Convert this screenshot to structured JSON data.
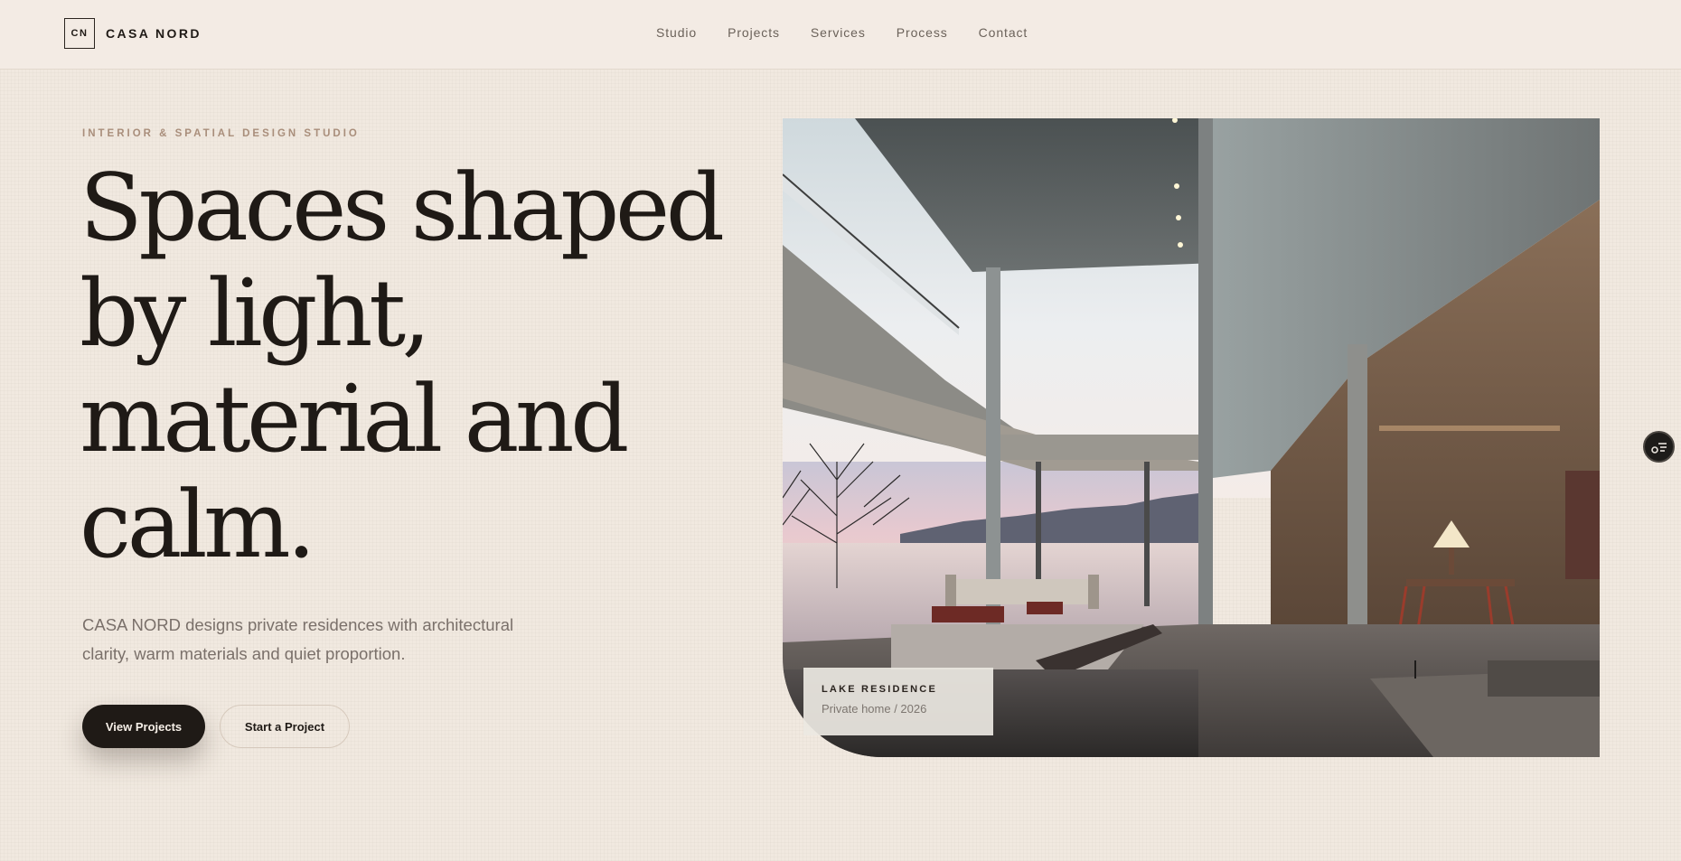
{
  "brand": {
    "mark": "CN",
    "name": "CASA NORD"
  },
  "nav": {
    "items": [
      "Studio",
      "Projects",
      "Services",
      "Process",
      "Contact"
    ]
  },
  "hero": {
    "eyebrow": "INTERIOR & SPATIAL DESIGN STUDIO",
    "headline": [
      "Spaces shaped",
      "by light,",
      "material and",
      "calm."
    ],
    "lead": "CASA NORD designs private residences with architectural clarity, warm materials and quiet proportion.",
    "primary_cta": "View Projects",
    "secondary_cta": "Start a Project"
  },
  "feature": {
    "caption_title": "LAKE RESIDENCE",
    "caption_sub": "Private home / 2026",
    "image_icon": "architectural-photo"
  },
  "widget": {
    "icon": "settings-list-icon"
  },
  "colors": {
    "background": "#f1e9e0",
    "ink": "#1f1a16",
    "accent": "#a98e7b",
    "muted": "#7a706a"
  }
}
